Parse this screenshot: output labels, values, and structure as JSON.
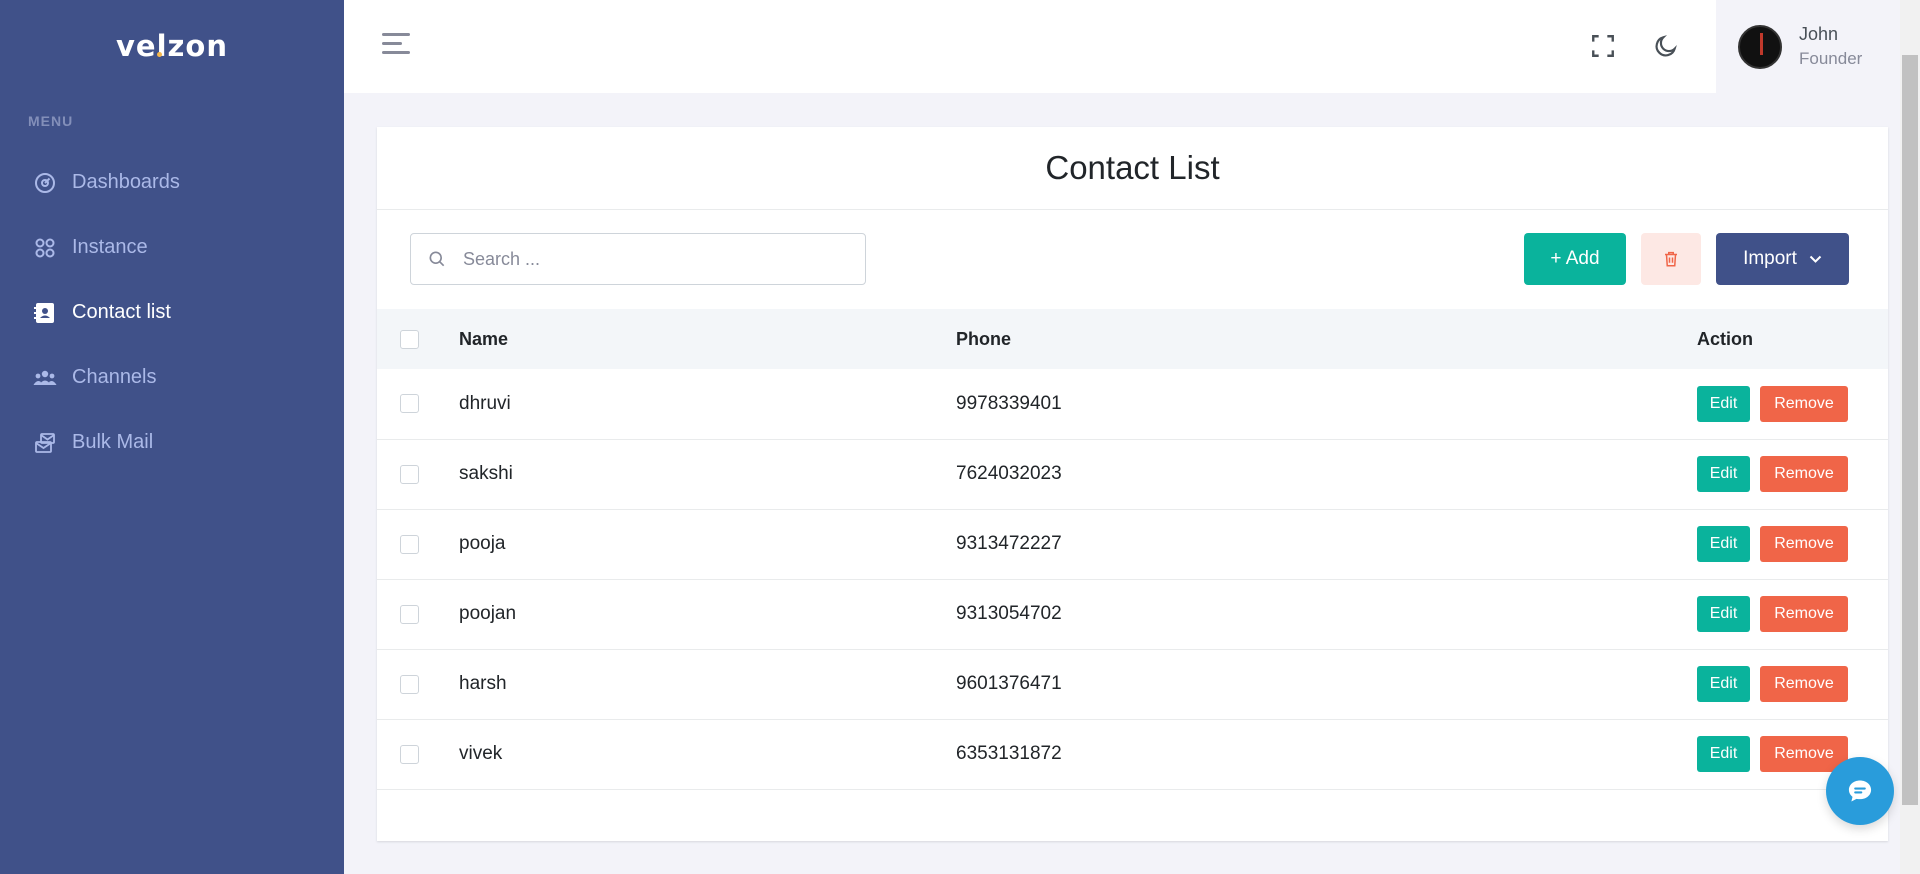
{
  "brand": {
    "logo_text": "velzon"
  },
  "sidebar": {
    "menu_title": "MENU",
    "items": [
      {
        "label": "Dashboards",
        "icon": "dashboard-gauge-icon",
        "active": false
      },
      {
        "label": "Instance",
        "icon": "apps-grid-icon",
        "active": false
      },
      {
        "label": "Contact list",
        "icon": "contact-book-icon",
        "active": true
      },
      {
        "label": "Channels",
        "icon": "team-icon",
        "active": false
      },
      {
        "label": "Bulk Mail",
        "icon": "mail-stack-icon",
        "active": false
      }
    ]
  },
  "topbar": {
    "fullscreen_icon": "fullscreen-icon",
    "theme_icon": "moon-icon",
    "user": {
      "name": "John",
      "role": "Founder"
    }
  },
  "card": {
    "title": "Contact List",
    "search_placeholder": "Search ...",
    "add_label": "+ Add",
    "import_label": "Import"
  },
  "table": {
    "headers": {
      "name": "Name",
      "phone": "Phone",
      "action": "Action"
    },
    "edit_label": "Edit",
    "remove_label": "Remove",
    "rows": [
      {
        "name": "dhruvi",
        "phone": "9978339401"
      },
      {
        "name": "sakshi",
        "phone": "7624032023"
      },
      {
        "name": "pooja",
        "phone": "9313472227"
      },
      {
        "name": "poojan",
        "phone": "9313054702"
      },
      {
        "name": "harsh",
        "phone": "9601376471"
      },
      {
        "name": "vivek",
        "phone": "6353131872"
      }
    ]
  },
  "colors": {
    "sidebar_bg": "#405189",
    "success": "#0ab39c",
    "danger": "#f06548",
    "primary": "#405189",
    "info": "#299cdb"
  }
}
